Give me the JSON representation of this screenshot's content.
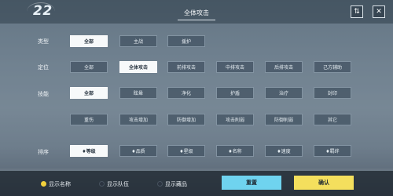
{
  "header": {
    "level": "22",
    "title": "全体攻击",
    "filter_icon_glyph": "⇅",
    "close_icon_glyph": "✕"
  },
  "rows": {
    "type": {
      "label": "类型",
      "options": [
        "全部",
        "主战",
        "援护"
      ],
      "selected": "全部"
    },
    "position": {
      "label": "定位",
      "options": [
        "全部",
        "全体攻击",
        "前排攻击",
        "中排攻击",
        "后排攻击",
        "己方辅助"
      ],
      "selected": "全体攻击"
    },
    "skill": {
      "label": "技能",
      "options": [
        "全部",
        "眩晕",
        "净化",
        "护盾",
        "治疗",
        "封印",
        "重伤",
        "攻击增加",
        "防御增加",
        "攻击削弱",
        "防御削弱",
        "其它"
      ],
      "selected": "全部"
    },
    "sort": {
      "label": "排序",
      "options": [
        "♦等级",
        "♦品质",
        "♦星级",
        "♦名称",
        "♦速度",
        "♦羁绊"
      ],
      "selected": "♦等级"
    }
  },
  "footer": {
    "show_name": {
      "label": "显示名称",
      "checked": true
    },
    "show_team": {
      "label": "显示队伍",
      "checked": false
    },
    "show_hidden": {
      "label": "显示藏品",
      "checked": false
    },
    "reset_label": "重置",
    "confirm_label": "确认"
  },
  "colors": {
    "radio_on": "#f2d13c",
    "radio_off": "#2b3440",
    "reset_bg": "#6fd3ef",
    "confirm_bg": "#f4df5d"
  }
}
